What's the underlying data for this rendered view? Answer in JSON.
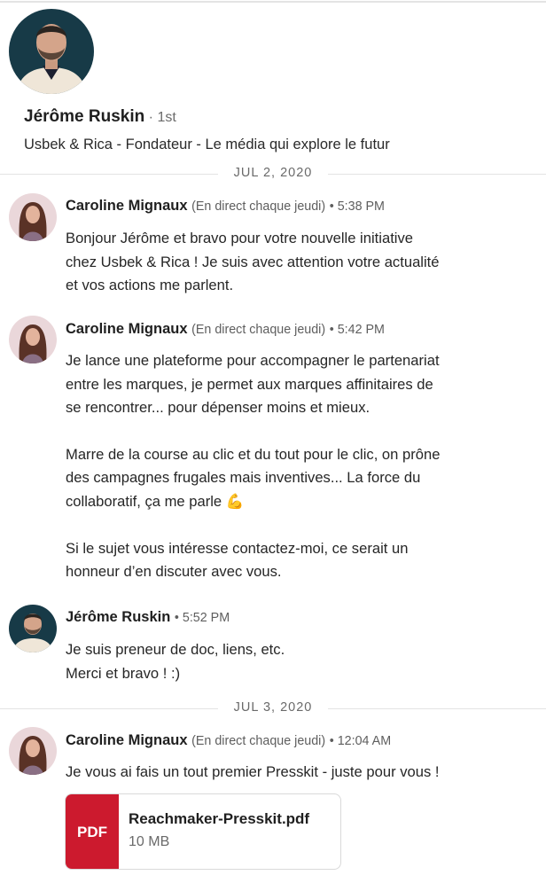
{
  "profile": {
    "name": "Jérôme Ruskin",
    "degree": " · 1st",
    "headline": "Usbek & Rica - Fondateur - Le média qui explore le futur"
  },
  "dates": [
    "JUL 2, 2020",
    "JUL 3, 2020"
  ],
  "messages": [
    {
      "sender": "Caroline Mignaux",
      "sub": "(En direct chaque jeudi)",
      "time": "• 5:38 PM",
      "lines": [
        "Bonjour Jérôme et bravo pour votre nouvelle initiative",
        "chez Usbek & Rica ! Je suis avec attention votre actualité",
        "et vos actions me parlent."
      ]
    },
    {
      "sender": "Caroline Mignaux",
      "sub": "(En direct chaque jeudi)",
      "time": "• 5:42 PM",
      "lines": [
        "Je lance une plateforme pour accompagner le partenariat",
        "entre les marques, je permet aux marques affinitaires de",
        "se rencontrer... pour dépenser moins et mieux.",
        "Marre de la course au clic et du tout pour le clic, on prône",
        "des campagnes frugales mais inventives... La force du",
        "collaboratif, ça me parle 💪",
        "Si le sujet vous intéresse contactez-moi, ce serait un",
        "honneur d’en discuter avec vous."
      ]
    },
    {
      "sender": "Jérôme Ruskin",
      "sub": "",
      "time": "• 5:52 PM",
      "lines": [
        "Je suis preneur de doc, liens, etc.",
        "Merci et bravo ! :)"
      ]
    },
    {
      "sender": "Caroline Mignaux",
      "sub": "(En direct chaque jeudi)",
      "time": "• 12:04 AM",
      "lines": [
        "Je vous ai fais un tout premier Presskit - juste pour vous !"
      ]
    }
  ],
  "attachment": {
    "badge": "PDF",
    "file_name": "Reachmaker-Presskit.pdf",
    "file_size": "10 MB",
    "badge_color": "#cc1a2e"
  }
}
